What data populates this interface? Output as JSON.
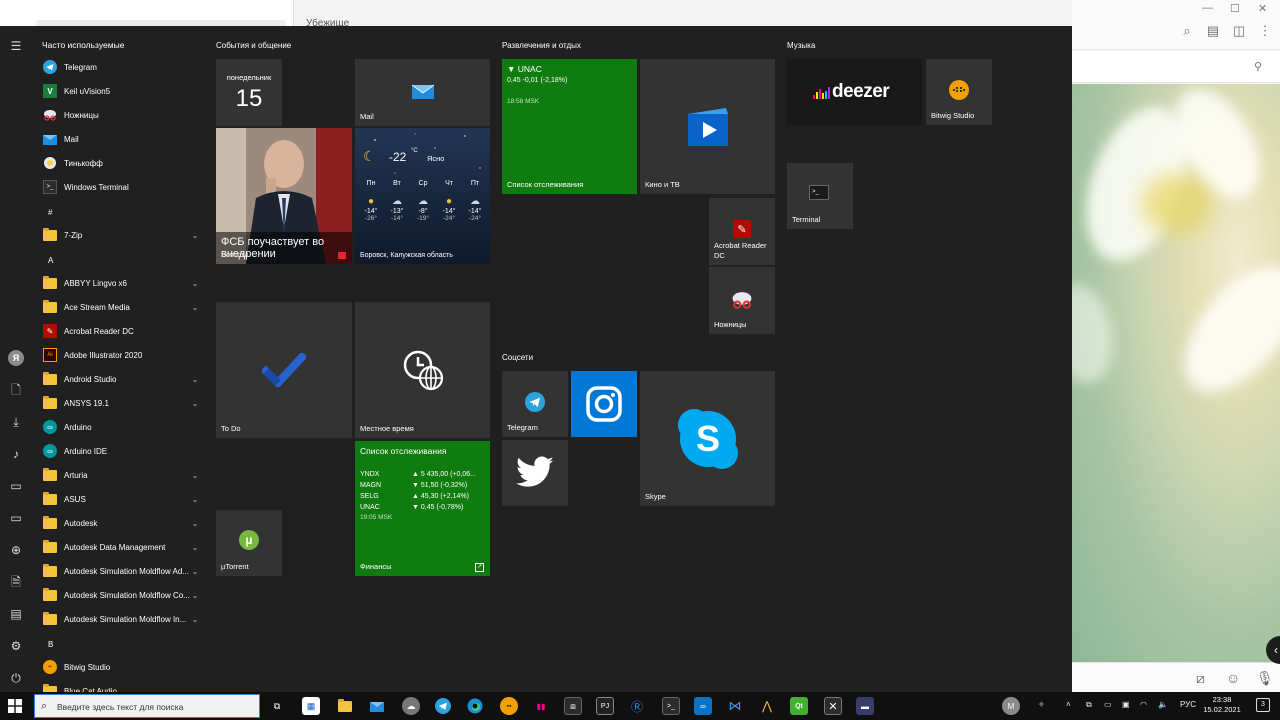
{
  "background_app": {
    "header_text": "Убежище",
    "window_controls": [
      "—",
      "☐",
      "✕"
    ]
  },
  "rail_avatar_letter": "Я",
  "app_list": {
    "header": "Часто используемые",
    "frequent": [
      {
        "label": "Telegram",
        "icon": "telegram-icon"
      },
      {
        "label": "Keil uVision5",
        "icon": "keil-icon"
      },
      {
        "label": "Ножницы",
        "icon": "snipping-icon"
      },
      {
        "label": "Mail",
        "icon": "mail-icon"
      },
      {
        "label": "Тинькофф",
        "icon": "tinkoff-icon"
      },
      {
        "label": "Windows Terminal",
        "icon": "terminal-icon"
      }
    ],
    "letter_hash": "#",
    "letter_a": "A",
    "letter_b": "B",
    "apps": [
      {
        "label": "7-Zip",
        "type": "folder",
        "chevron": true
      },
      {
        "label": "ABBYY Lingvo x6",
        "type": "folder",
        "chevron": true
      },
      {
        "label": "Ace Stream Media",
        "type": "folder",
        "chevron": true
      },
      {
        "label": "Acrobat Reader DC",
        "type": "acrobat",
        "chevron": false
      },
      {
        "label": "Adobe Illustrator 2020",
        "type": "illustrator",
        "chevron": false
      },
      {
        "label": "Android Studio",
        "type": "folder",
        "chevron": true
      },
      {
        "label": "ANSYS 19.1",
        "type": "folder",
        "chevron": true
      },
      {
        "label": "Arduino",
        "type": "arduino",
        "chevron": false
      },
      {
        "label": "Arduino IDE",
        "type": "arduino",
        "chevron": false
      },
      {
        "label": "Arturia",
        "type": "folder",
        "chevron": true
      },
      {
        "label": "ASUS",
        "type": "folder",
        "chevron": true
      },
      {
        "label": "Autodesk",
        "type": "folder",
        "chevron": true
      },
      {
        "label": "Autodesk Data Management",
        "type": "folder",
        "chevron": true
      },
      {
        "label": "Autodesk Simulation Moldflow Ad...",
        "type": "folder",
        "chevron": true
      },
      {
        "label": "Autodesk Simulation Moldflow Co...",
        "type": "folder",
        "chevron": true
      },
      {
        "label": "Autodesk Simulation Moldflow In...",
        "type": "folder",
        "chevron": true
      },
      {
        "label": "Bitwig Studio",
        "type": "bitwig",
        "chevron": false
      },
      {
        "label": "Blue Cat Audio",
        "type": "folder",
        "chevron": true
      }
    ]
  },
  "groups": {
    "events": "События и общение",
    "entertainment": "Развлечения и отдых",
    "music": "Музыка",
    "social": "Соцсети"
  },
  "tiles": {
    "calendar": {
      "day_name": "понедельник",
      "day_number": "15"
    },
    "mail": {
      "label": "Mail"
    },
    "news": {
      "headline": "ФСБ поучаствует во внедрении",
      "label": "Новости"
    },
    "weather": {
      "temp": "-22",
      "unit": "°C",
      "condition": "Ясно",
      "location": "Боровск, Калужская область",
      "forecast": [
        {
          "day": "Пн",
          "hi": "-14°",
          "lo": "-26°",
          "icon": "sun-icon"
        },
        {
          "day": "Вт",
          "hi": "-13°",
          "lo": "-14°",
          "icon": "cloud-snow-icon"
        },
        {
          "day": "Ср",
          "hi": "-8°",
          "lo": "-19°",
          "icon": "cloud-snow-icon"
        },
        {
          "day": "Чт",
          "hi": "-14°",
          "lo": "-24°",
          "icon": "sun-icon"
        },
        {
          "day": "Пт",
          "hi": "-14°",
          "lo": "-24°",
          "icon": "cloud-snow-icon"
        }
      ]
    },
    "stock_small": {
      "ticker": "▼ UNAC",
      "change": "0,45 -0,01 (-2,18%)",
      "time": "18:58 MSK",
      "label": "Список отслеживания"
    },
    "movies": {
      "label": "Кино и ТВ"
    },
    "acrobat": {
      "label": "Acrobat Reader DC"
    },
    "snipping": {
      "label": "Ножницы"
    },
    "todo": {
      "label": "To Do"
    },
    "localtime": {
      "label": "Местное время"
    },
    "finance": {
      "title": "Список отслеживания",
      "rows": [
        {
          "ticker": "YNDX",
          "value": "▲ 5 435,00 (+0,06..."
        },
        {
          "ticker": "MAGN",
          "value": "▼ 51,50 (-0,32%)"
        },
        {
          "ticker": "SELG",
          "value": "▲ 45,30 (+2,14%)"
        },
        {
          "ticker": "UNAC",
          "value": "▼ 0,45 (-0,78%)"
        }
      ],
      "time": "19:05 MSK",
      "label": "Финансы"
    },
    "utorrent": {
      "label": "µTorrent"
    },
    "deezer": {
      "wordmark": "deezer"
    },
    "bitwig": {
      "label": "Bitwig Studio"
    },
    "terminal": {
      "label": "Terminal"
    },
    "telegram": {
      "label": "Telegram"
    },
    "skype": {
      "label": "Skype"
    }
  },
  "taskbar": {
    "search_placeholder": "Введите здесь текст для поиска",
    "avatar_letter": "M",
    "language": "РУС",
    "time": "23:38",
    "date": "15.02.2021",
    "notification_count": "3"
  },
  "colors": {
    "start_bg": "#202020",
    "tile_bg": "#333333",
    "finance_green": "#107c10",
    "instagram_blue": "#0078d7",
    "accent": "#0078d7"
  }
}
